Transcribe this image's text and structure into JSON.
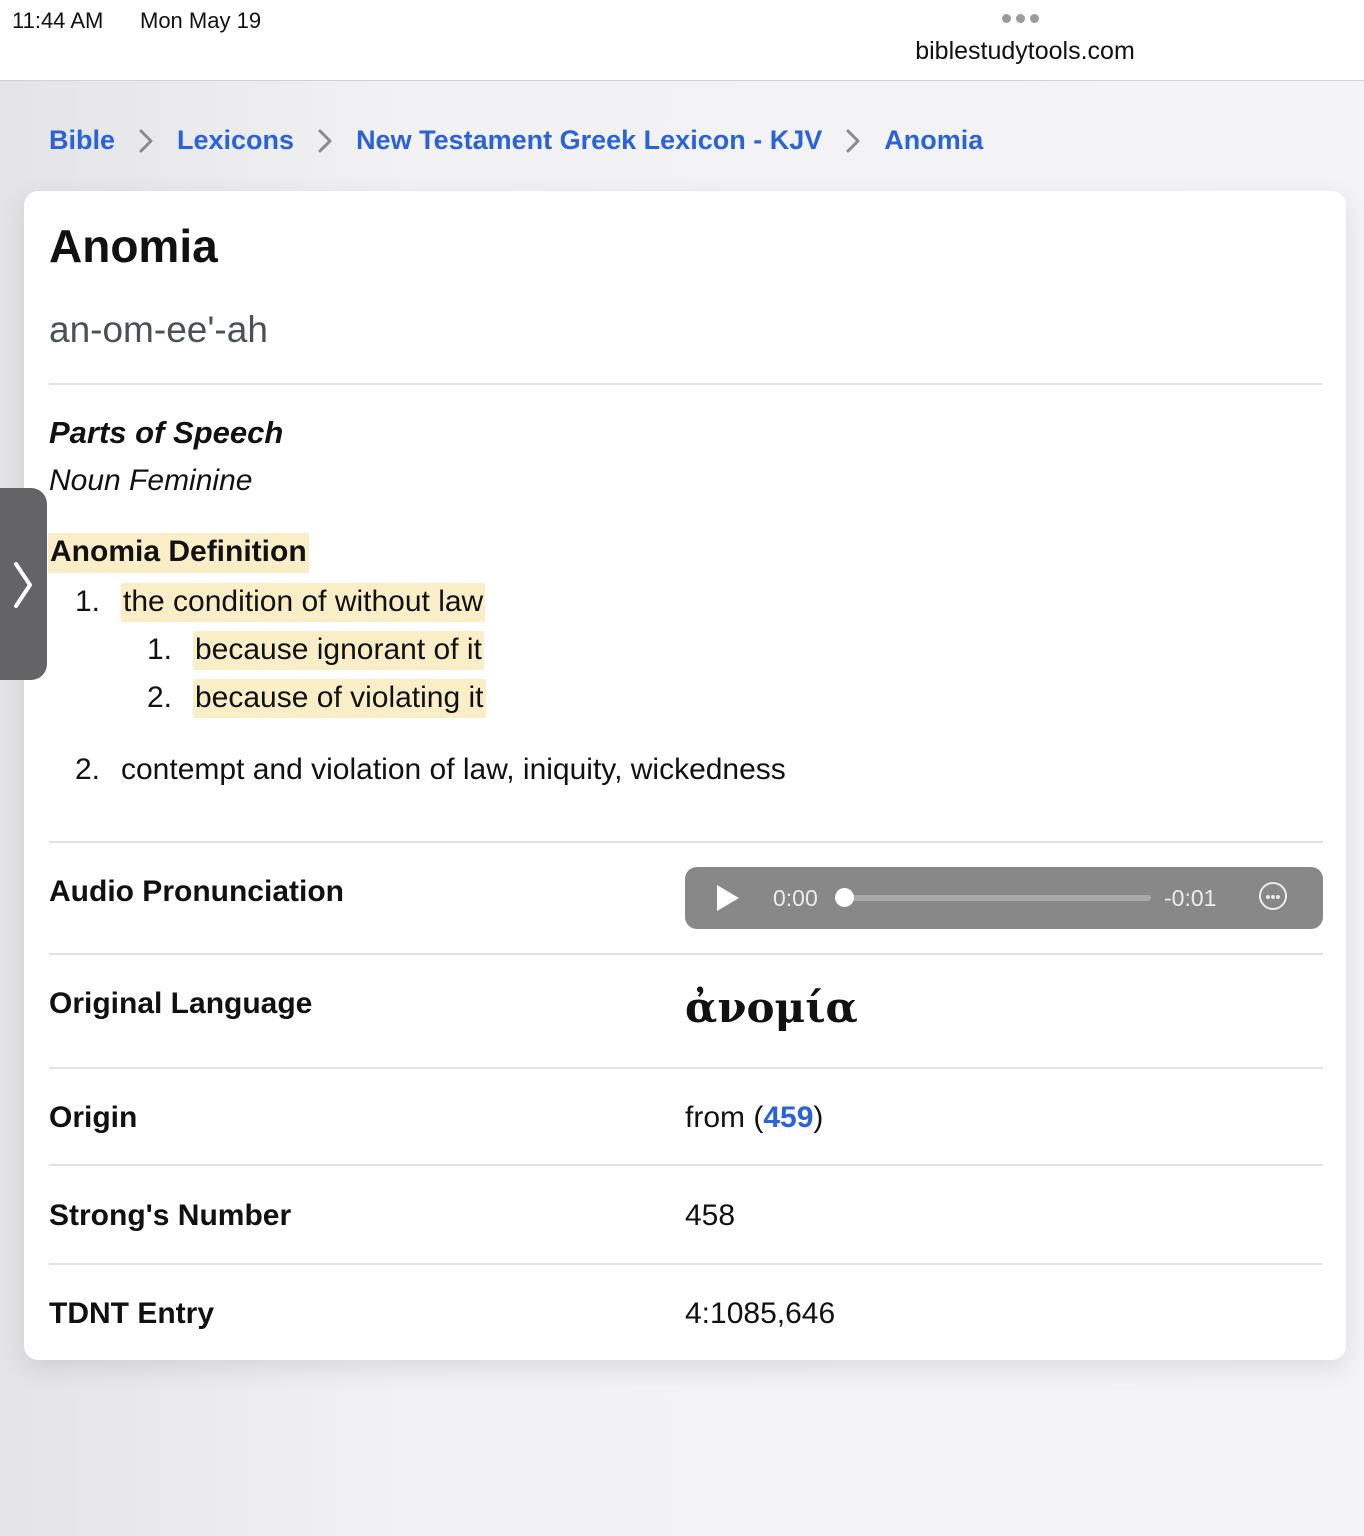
{
  "status_bar": {
    "time": "11:44 AM",
    "date": "Mon May 19",
    "url": "biblestudytools.com"
  },
  "breadcrumb": [
    "Bible",
    "Lexicons",
    "New Testament Greek Lexicon - KJV",
    "Anomia"
  ],
  "entry": {
    "title": "Anomia",
    "pronunciation": "an-om-ee'-ah",
    "parts_of_speech_label": "Parts of Speech",
    "parts_of_speech": "Noun Feminine",
    "definition_heading": "Anomia Definition",
    "definitions": [
      {
        "num": "1.",
        "text": "the condition of without law",
        "sub": [
          {
            "num": "1.",
            "text": "because ignorant of it"
          },
          {
            "num": "2.",
            "text": "because of violating it"
          }
        ]
      },
      {
        "num": "2.",
        "text": "contempt and violation of law, iniquity, wickedness"
      }
    ]
  },
  "details": {
    "audio_label": "Audio Pronunciation",
    "audio": {
      "current": "0:00",
      "remaining": "-0:01",
      "progress": 0
    },
    "original_language_label": "Original Language",
    "original_language": "ἀνομία",
    "origin_label": "Origin",
    "origin_prefix": "from (",
    "origin_link": "459",
    "origin_suffix": ")",
    "strongs_label": "Strong's Number",
    "strongs": "458",
    "tdnt_label": "TDNT Entry",
    "tdnt": "4:1085,646"
  },
  "colors": {
    "link": "#2962d9",
    "highlight": "#faeec8"
  },
  "icons": [
    "chevron-right-icon",
    "play-icon",
    "more-options-icon",
    "sidebar-chevron-icon"
  ]
}
